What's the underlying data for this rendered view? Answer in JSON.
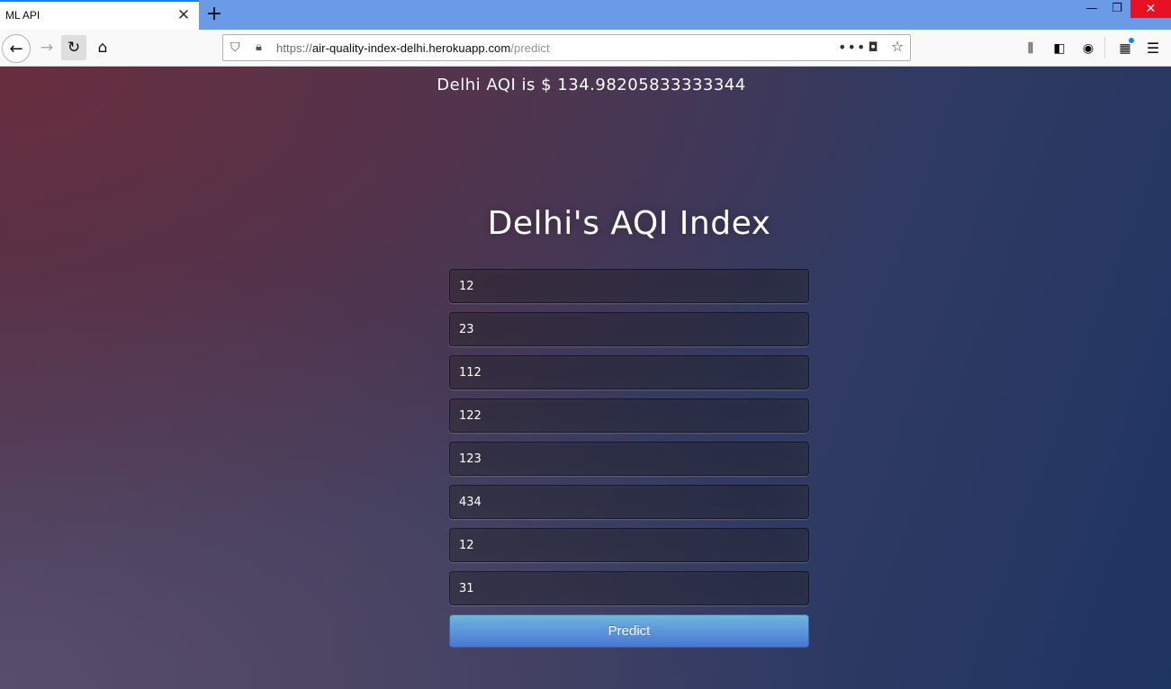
{
  "browser": {
    "tab_title": "ML API",
    "url_prefix": "https://",
    "url_host": "air-quality-index-delhi.herokuapp.com",
    "url_path": "/predict"
  },
  "page": {
    "result": "Delhi AQI is $ 134.98205833333344",
    "title": "Delhi's AQI Index",
    "fields": [
      "12",
      "23",
      "112",
      "122",
      "123",
      "434",
      "12",
      "31"
    ],
    "predict_label": "Predict"
  },
  "colors": {
    "button_top": "#6eb6de",
    "button_bottom": "#4a77d4",
    "tabbar": "#6b9be6"
  }
}
